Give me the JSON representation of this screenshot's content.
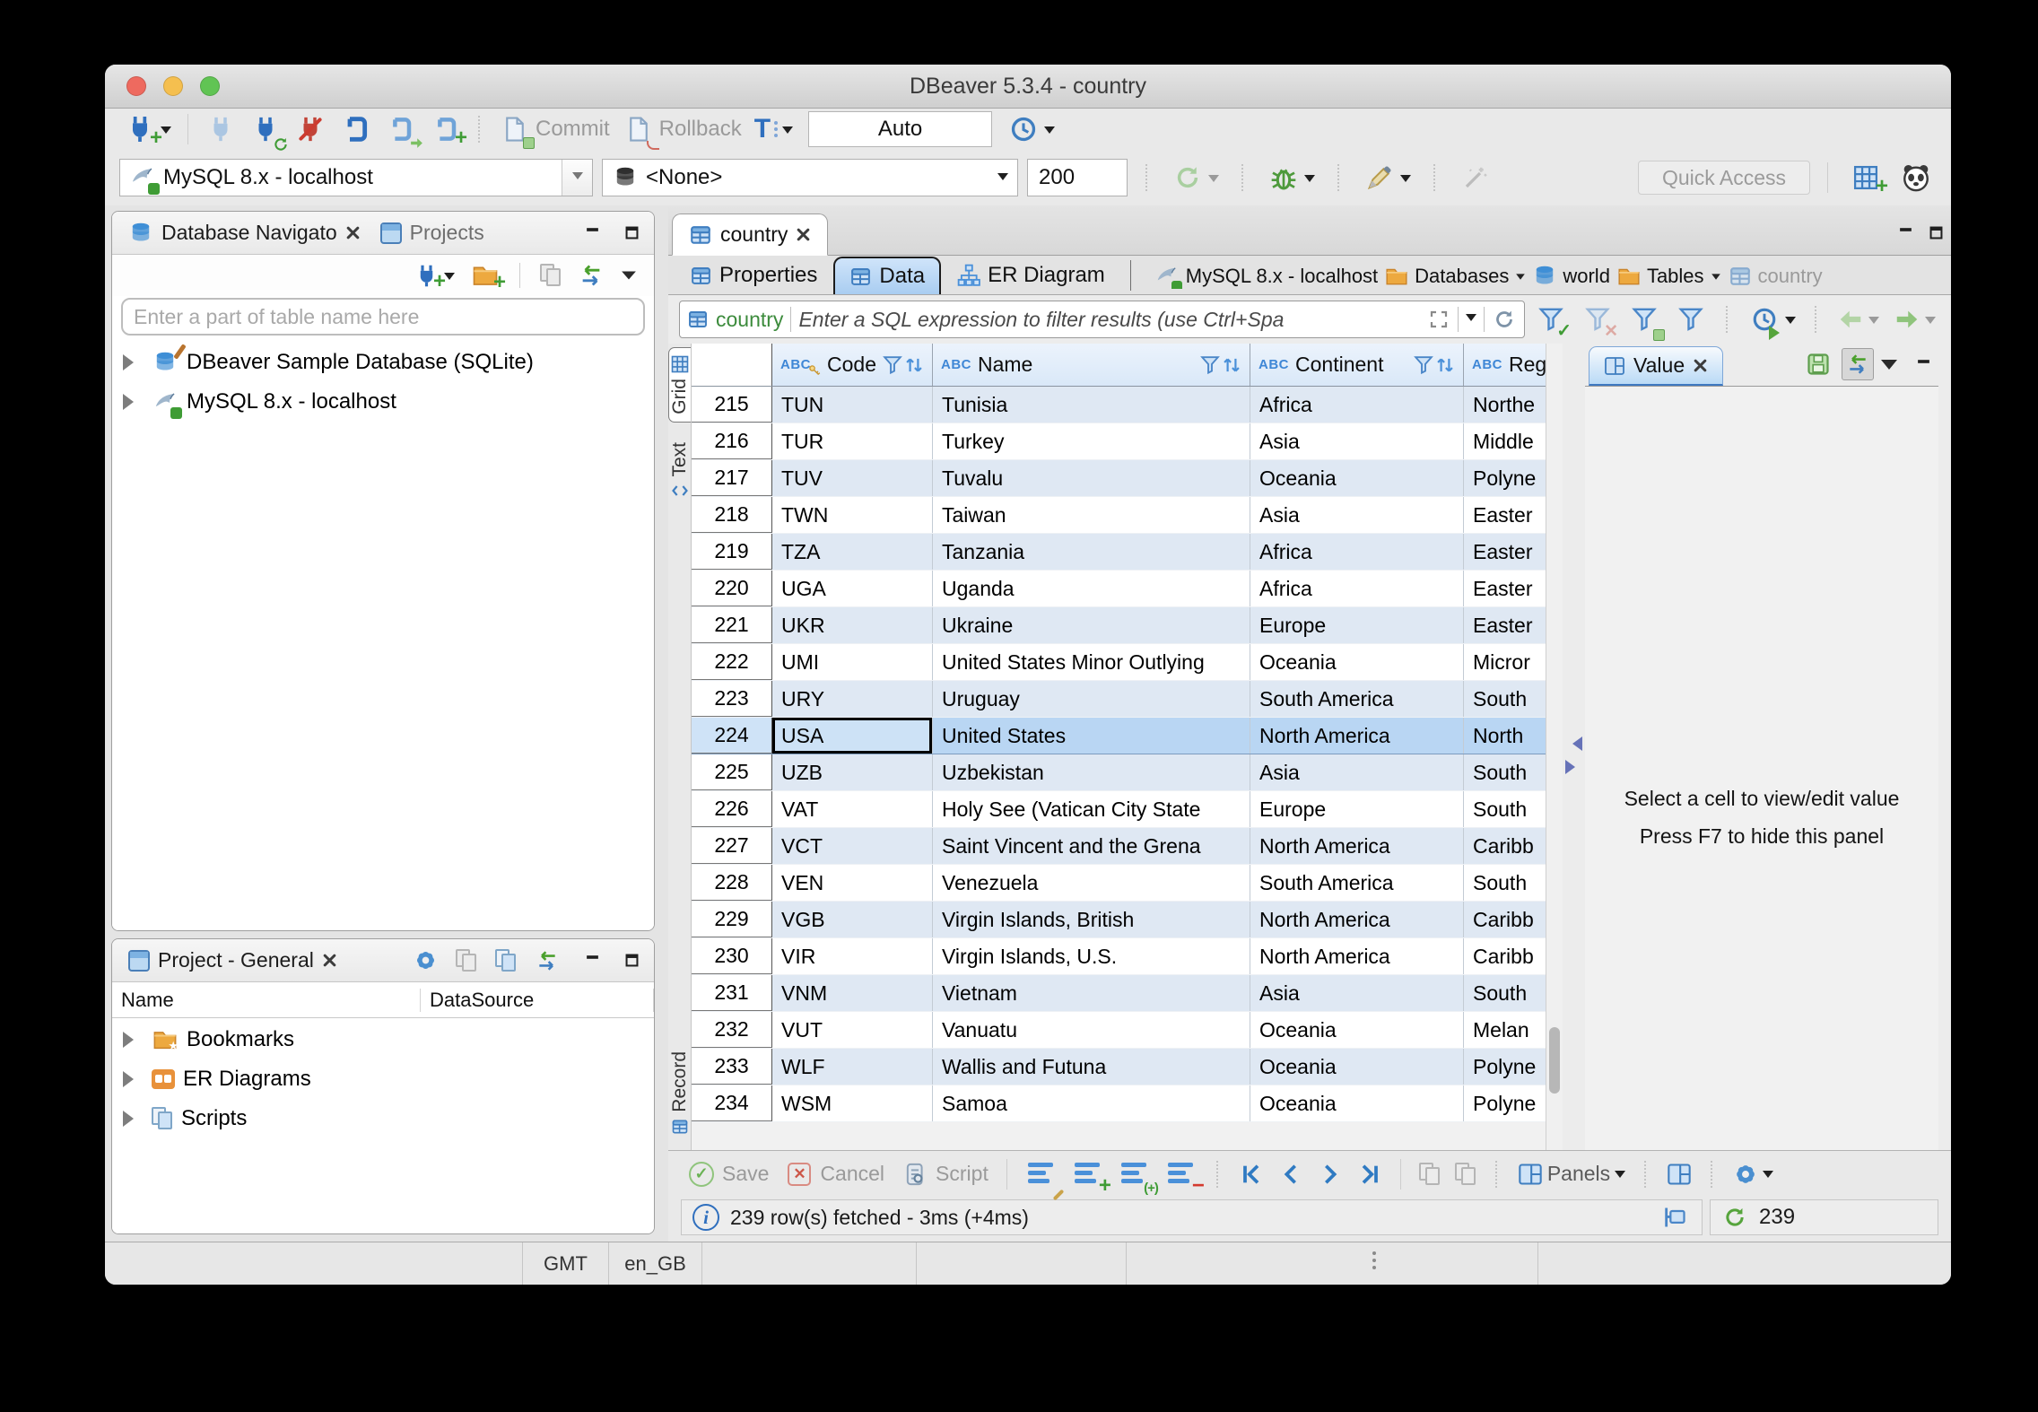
{
  "window": {
    "title": "DBeaver 5.3.4 - country",
    "statusbar": {
      "timezone": "GMT",
      "locale": "en_GB"
    }
  },
  "toolbar": {
    "commit": "Commit",
    "rollback": "Rollback",
    "txn_mode": "Auto",
    "connection": "MySQL 8.x - localhost",
    "database": "<None>",
    "fetch_size": "200",
    "quick_access": "Quick Access"
  },
  "navigator": {
    "tab_database_navigator": "Database Navigato",
    "tab_projects": "Projects",
    "filter_placeholder": "Enter a part of table name here",
    "tree": [
      {
        "label": "DBeaver Sample Database (SQLite)"
      },
      {
        "label": "MySQL 8.x - localhost"
      }
    ]
  },
  "project_panel": {
    "tab": "Project - General",
    "col_name": "Name",
    "col_datasource": "DataSource",
    "tree": [
      {
        "label": "Bookmarks"
      },
      {
        "label": "ER Diagrams"
      },
      {
        "label": "Scripts"
      }
    ]
  },
  "editor": {
    "tab": "country",
    "subtab_properties": "Properties",
    "subtab_data": "Data",
    "subtab_er": "ER Diagram",
    "breadcrumb": [
      "MySQL 8.x - localhost",
      "Databases",
      "world",
      "Tables",
      "country"
    ],
    "filter": {
      "table": "country",
      "placeholder": "Enter a SQL expression to filter results (use Ctrl+Spa"
    },
    "side_tabs": {
      "grid": "Grid",
      "text": "Text",
      "record": "Record"
    },
    "grid": {
      "type_label": "ABC",
      "columns": [
        "Code",
        "Name",
        "Continent",
        "Reg"
      ],
      "rows": [
        {
          "num": "215",
          "code": "TUN",
          "name": "Tunisia",
          "continent": "Africa",
          "region": "Northe"
        },
        {
          "num": "216",
          "code": "TUR",
          "name": "Turkey",
          "continent": "Asia",
          "region": "Middle"
        },
        {
          "num": "217",
          "code": "TUV",
          "name": "Tuvalu",
          "continent": "Oceania",
          "region": "Polyne"
        },
        {
          "num": "218",
          "code": "TWN",
          "name": "Taiwan",
          "continent": "Asia",
          "region": "Easter"
        },
        {
          "num": "219",
          "code": "TZA",
          "name": "Tanzania",
          "continent": "Africa",
          "region": "Easter"
        },
        {
          "num": "220",
          "code": "UGA",
          "name": "Uganda",
          "continent": "Africa",
          "region": "Easter"
        },
        {
          "num": "221",
          "code": "UKR",
          "name": "Ukraine",
          "continent": "Europe",
          "region": "Easter"
        },
        {
          "num": "222",
          "code": "UMI",
          "name": "United States Minor Outlying",
          "continent": "Oceania",
          "region": "Micror"
        },
        {
          "num": "223",
          "code": "URY",
          "name": "Uruguay",
          "continent": "South America",
          "region": "South"
        },
        {
          "num": "224",
          "code": "USA",
          "name": "United States",
          "continent": "North America",
          "region": "North",
          "selected": true
        },
        {
          "num": "225",
          "code": "UZB",
          "name": "Uzbekistan",
          "continent": "Asia",
          "region": "South"
        },
        {
          "num": "226",
          "code": "VAT",
          "name": "Holy See (Vatican City State",
          "continent": "Europe",
          "region": "South"
        },
        {
          "num": "227",
          "code": "VCT",
          "name": "Saint Vincent and the Grena",
          "continent": "North America",
          "region": "Caribb"
        },
        {
          "num": "228",
          "code": "VEN",
          "name": "Venezuela",
          "continent": "South America",
          "region": "South"
        },
        {
          "num": "229",
          "code": "VGB",
          "name": "Virgin Islands, British",
          "continent": "North America",
          "region": "Caribb"
        },
        {
          "num": "230",
          "code": "VIR",
          "name": "Virgin Islands, U.S.",
          "continent": "North America",
          "region": "Caribb"
        },
        {
          "num": "231",
          "code": "VNM",
          "name": "Vietnam",
          "continent": "Asia",
          "region": "South"
        },
        {
          "num": "232",
          "code": "VUT",
          "name": "Vanuatu",
          "continent": "Oceania",
          "region": "Melan"
        },
        {
          "num": "233",
          "code": "WLF",
          "name": "Wallis and Futuna",
          "continent": "Oceania",
          "region": "Polyne"
        },
        {
          "num": "234",
          "code": "WSM",
          "name": "Samoa",
          "continent": "Oceania",
          "region": "Polyne"
        }
      ]
    },
    "value_panel": {
      "tab": "Value",
      "hint1": "Select a cell to view/edit value",
      "hint2": "Press F7 to hide this panel"
    },
    "grid_toolbar": {
      "save": "Save",
      "cancel": "Cancel",
      "script": "Script",
      "panels": "Panels"
    },
    "status": {
      "message": "239 row(s) fetched - 3ms (+4ms)",
      "refresh_count": "239"
    }
  },
  "icons": {
    "connection": "plug",
    "database": "cylinder",
    "mysql": "dolphin-with-check",
    "filter": "funnel",
    "sort": "up-down-arrows",
    "primary_key": "gold-key",
    "refresh": "circular-arrows",
    "transaction": "blue-T",
    "logo": "panda-face"
  }
}
